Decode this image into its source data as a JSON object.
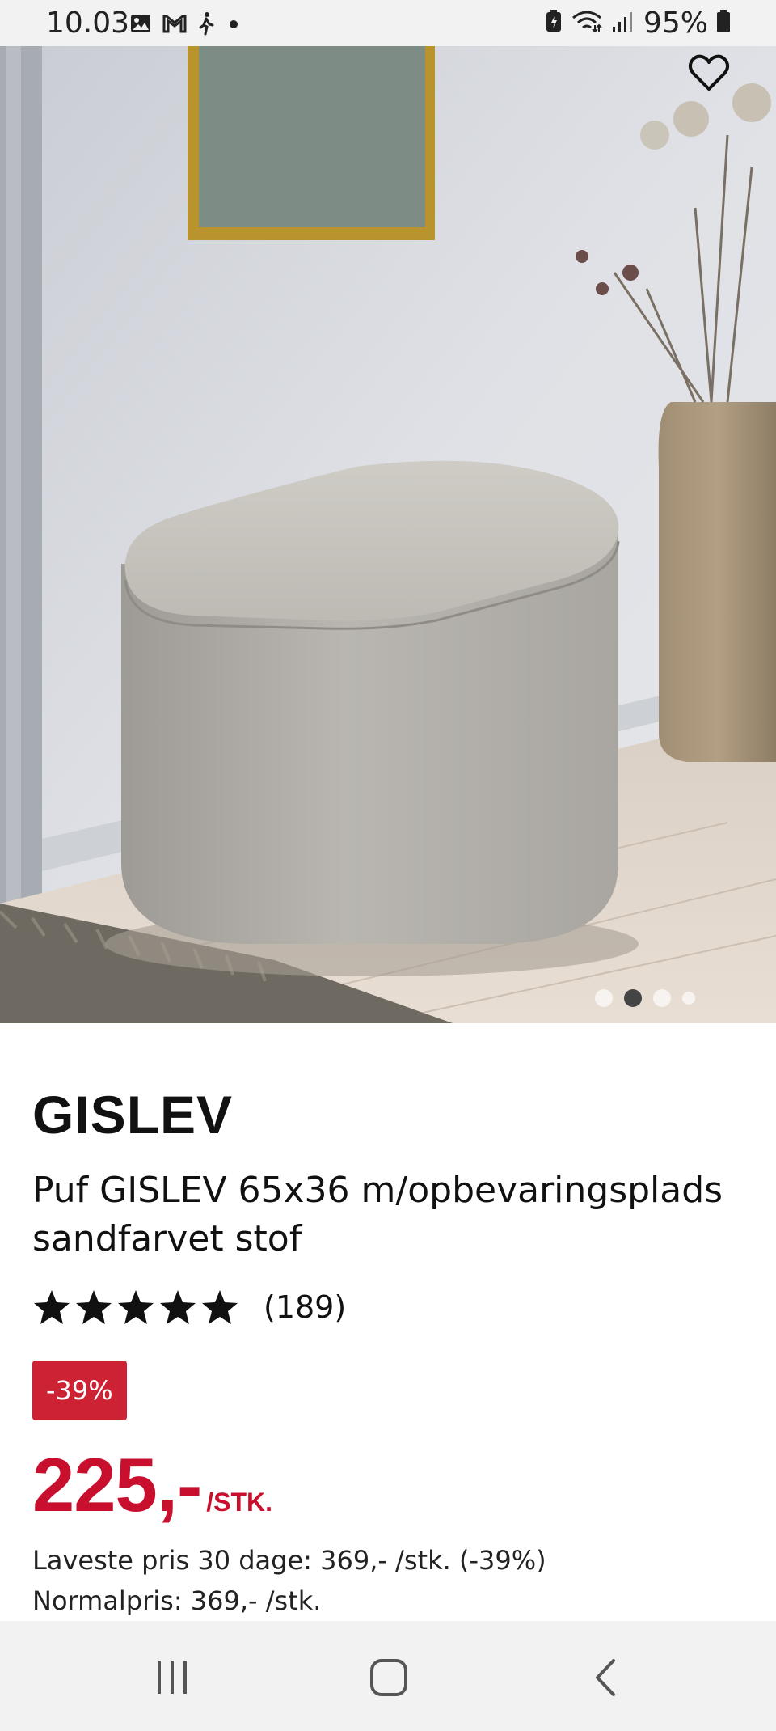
{
  "status_bar": {
    "time": "10.03",
    "battery": "95%",
    "left_icons": [
      "gallery-icon",
      "gmail-icon",
      "walking-icon",
      "dot-icon"
    ],
    "right_icons": [
      "battery-saver-icon",
      "wifi-icon",
      "signal-icon",
      "battery-icon"
    ]
  },
  "gallery": {
    "favorite_icon": "heart-outline-icon",
    "image_count": 4,
    "active_index": 1
  },
  "product": {
    "brand": "GISLEV",
    "description": "Puf GISLEV 65x36 m/opbevaringsplads sandfarvet stof",
    "rating_stars": 5,
    "review_count": "(189)",
    "discount": "-39%",
    "price": "225,-",
    "price_unit": "/STK.",
    "lowest_price_note": "Laveste pris 30 dage: 369,- /stk. (-39%)",
    "normal_price_note": "Normalpris: 369,- /stk."
  },
  "colors": {
    "accent_red": "#c8102e",
    "badge_red": "#cc2233"
  },
  "nav_bar": {
    "icons": [
      "recent-apps-icon",
      "home-icon",
      "back-icon"
    ]
  }
}
